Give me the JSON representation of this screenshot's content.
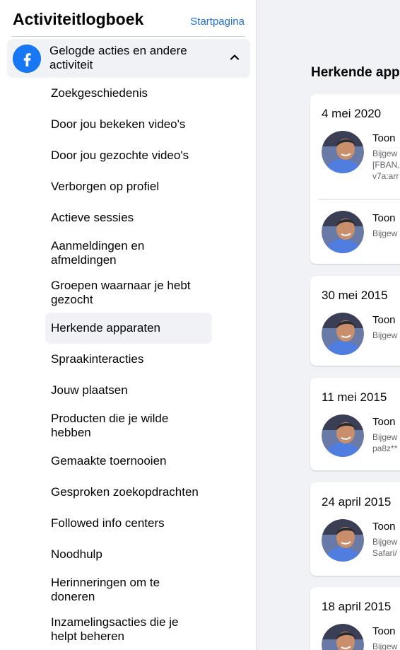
{
  "sidebar": {
    "title": "Activiteitlogboek",
    "home_link": "Startpagina",
    "group": {
      "icon": "facebook-icon",
      "label": "Gelogde acties en andere activiteit",
      "chevron": "chevron-up-icon"
    },
    "items": [
      {
        "label": "Zoekgeschiedenis"
      },
      {
        "label": "Door jou bekeken video's"
      },
      {
        "label": "Door jou gezochte video's"
      },
      {
        "label": "Verborgen op profiel"
      },
      {
        "label": "Actieve sessies"
      },
      {
        "label": "Aanmeldingen en afmeldingen"
      },
      {
        "label": "Groepen waarnaar je hebt gezocht"
      },
      {
        "label": "Herkende apparaten",
        "active": true
      },
      {
        "label": "Spraakinteracties"
      },
      {
        "label": "Jouw plaatsen"
      },
      {
        "label": "Producten die je wilde hebben"
      },
      {
        "label": "Gemaakte toernooien"
      },
      {
        "label": "Gesproken zoekopdrachten"
      },
      {
        "label": "Followed info centers"
      },
      {
        "label": "Noodhulp"
      },
      {
        "label": "Herinneringen om te doneren"
      },
      {
        "label": "Inzamelingsacties die je helpt beheren"
      }
    ]
  },
  "main": {
    "section_title": "Herkende app",
    "cards": [
      {
        "date": "4 mei 2020",
        "entries": [
          {
            "name": "Toon",
            "detail": "Bijgew\n[FBAN,\nv7a:arr"
          },
          {
            "name": "Toon",
            "detail": "Bijgew"
          }
        ]
      },
      {
        "date": "30 mei 2015",
        "entries": [
          {
            "name": "Toon",
            "detail": "Bijgew"
          }
        ]
      },
      {
        "date": "11 mei 2015",
        "entries": [
          {
            "name": "Toon",
            "detail": "Bijgew\npa8z**"
          }
        ]
      },
      {
        "date": "24 april 2015",
        "entries": [
          {
            "name": "Toon",
            "detail": "Bijgew\nSafari/"
          }
        ]
      },
      {
        "date": "18 april 2015",
        "entries": [
          {
            "name": "Toon",
            "detail": "Bijgew"
          }
        ]
      }
    ]
  },
  "colors": {
    "accent": "#1877f2",
    "link": "#216fdb",
    "page_bg": "#f0f2f5",
    "secondary_text": "#65676b"
  }
}
